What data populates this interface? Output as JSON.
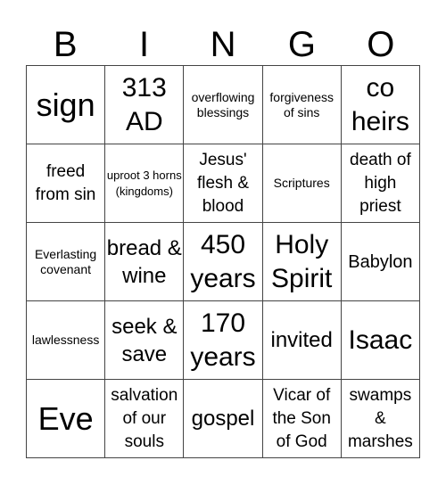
{
  "header": {
    "letters": [
      "B",
      "I",
      "N",
      "G",
      "O"
    ]
  },
  "cells": [
    {
      "text": "sign",
      "size": "xl"
    },
    {
      "text": "313 AD",
      "size": "l"
    },
    {
      "text": "overflowing blessings",
      "size": "xs"
    },
    {
      "text": "forgiveness of sins",
      "size": "xs"
    },
    {
      "text": "co heirs",
      "size": "l"
    },
    {
      "text": "freed from sin",
      "size": "s"
    },
    {
      "text": "uproot 3 horns (kingdoms)",
      "size": "xxs"
    },
    {
      "text": "Jesus' flesh & blood",
      "size": "s"
    },
    {
      "text": "Scriptures",
      "size": "xs"
    },
    {
      "text": "death of high priest",
      "size": "s"
    },
    {
      "text": "Everlasting covenant",
      "size": "xs"
    },
    {
      "text": "bread & wine",
      "size": "m"
    },
    {
      "text": "450 years",
      "size": "l"
    },
    {
      "text": "Holy Spirit",
      "size": "l"
    },
    {
      "text": "Babylon",
      "size": "ms"
    },
    {
      "text": "lawlessness",
      "size": "xs"
    },
    {
      "text": "seek & save",
      "size": "m"
    },
    {
      "text": "170 years",
      "size": "l"
    },
    {
      "text": "invited",
      "size": "m"
    },
    {
      "text": "Isaac",
      "size": "l"
    },
    {
      "text": "Eve",
      "size": "xl"
    },
    {
      "text": "salvation of our souls",
      "size": "s"
    },
    {
      "text": "gospel",
      "size": "m"
    },
    {
      "text": "Vicar of the Son of God",
      "size": "s"
    },
    {
      "text": "swamps & marshes",
      "size": "s"
    }
  ]
}
